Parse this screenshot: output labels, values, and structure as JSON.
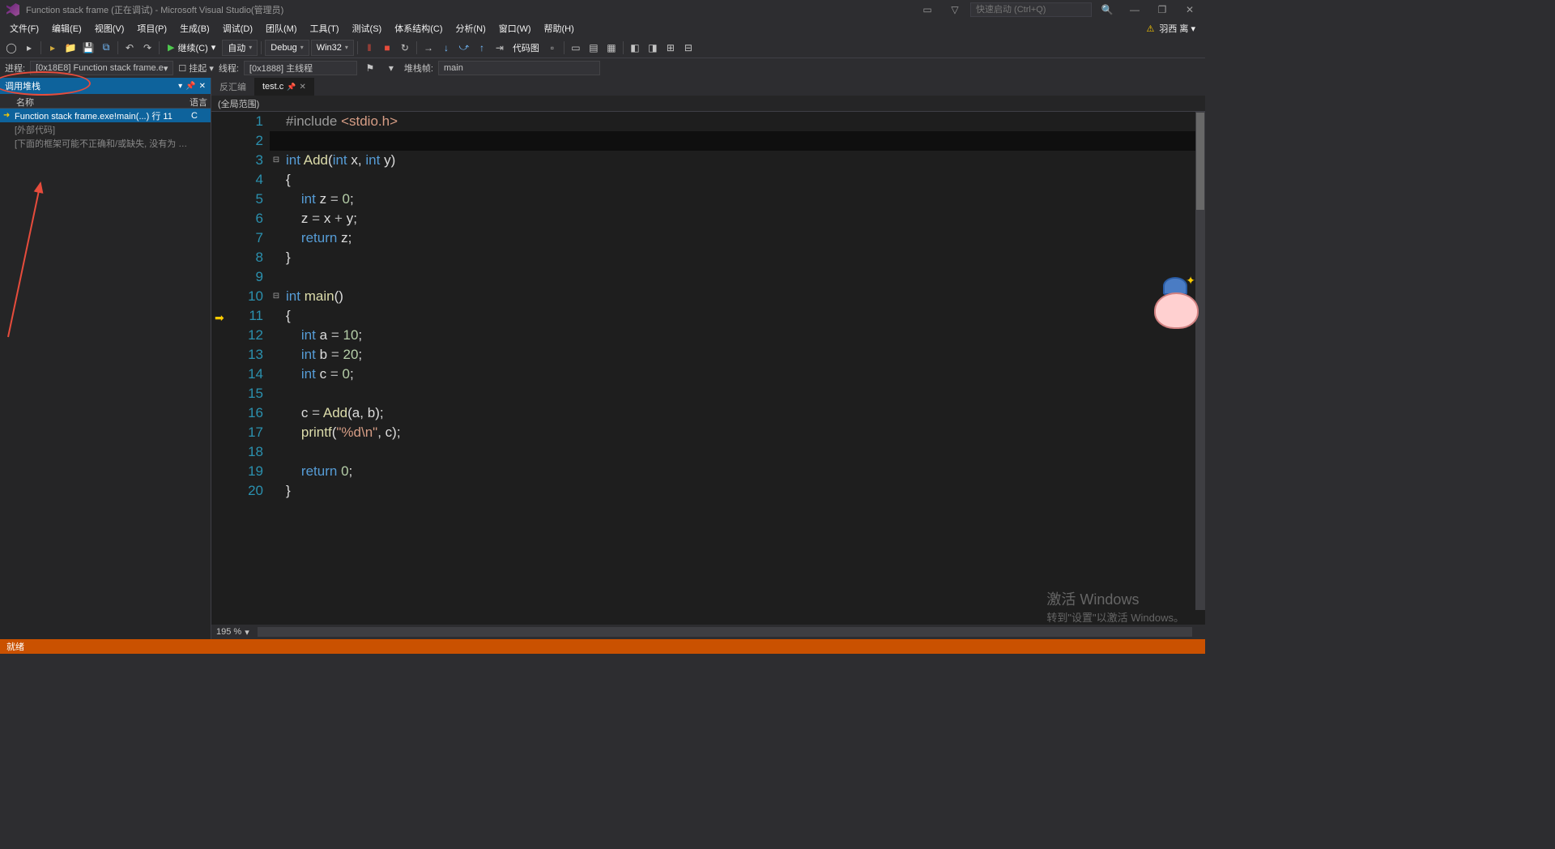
{
  "titlebar": {
    "title": "Function stack frame (正在调试) - Microsoft Visual Studio(管理员)",
    "search_placeholder": "快速启动 (Ctrl+Q)"
  },
  "menus": [
    "文件(F)",
    "编辑(E)",
    "视图(V)",
    "项目(P)",
    "生成(B)",
    "调试(D)",
    "团队(M)",
    "工具(T)",
    "测试(S)",
    "体系结构(C)",
    "分析(N)",
    "窗口(W)",
    "帮助(H)"
  ],
  "user_badge": "羽西 离 ▾",
  "toolbar": {
    "continue": "继续(C)",
    "config": "自动",
    "solution_cfg": "Debug",
    "platform": "Win32",
    "codemap": "代码图"
  },
  "process_bar": {
    "proc_label": "进程:",
    "proc_val": "[0x18E8] Function stack frame.e",
    "suspend": "挂起",
    "thread_label": "线程:",
    "thread_val": "[0x1888] 主线程",
    "frame_label": "堆栈帧:",
    "frame_val": "main"
  },
  "callstack": {
    "title": "调用堆栈",
    "col_name": "名称",
    "col_lang": "语言",
    "rows": [
      {
        "arrow": "➜",
        "name": "Function stack frame.exe!main(...) 行 11",
        "lang": "C",
        "selected": true
      },
      {
        "arrow": "",
        "name": "[外部代码]",
        "lang": "",
        "dim": true
      },
      {
        "arrow": "",
        "name": "[下面的框架可能不正确和/或缺失, 没有为 kernel",
        "lang": "",
        "dim": true
      }
    ]
  },
  "editor": {
    "tabs": [
      {
        "label": "反汇编",
        "active": false
      },
      {
        "label": "test.c",
        "active": true,
        "pinned": true
      }
    ],
    "scope": "(全局范围)",
    "zoom": "195 %",
    "lines": [
      1,
      2,
      3,
      4,
      5,
      6,
      7,
      8,
      9,
      10,
      11,
      12,
      13,
      14,
      15,
      16,
      17,
      18,
      19,
      20
    ],
    "code": [
      {
        "n": 1,
        "fold": "",
        "html": "<span class='pp'>#include</span> <span class='inc'>&lt;stdio.h&gt;</span>"
      },
      {
        "n": 2,
        "fold": "",
        "html": ""
      },
      {
        "n": 3,
        "fold": "⊟",
        "html": "<span class='ty'>int</span> <span class='fn'>Add</span><span class='pn'>(</span><span class='ty'>int</span> <span class='id'>x</span><span class='pn'>,</span> <span class='ty'>int</span> <span class='id'>y</span><span class='pn'>)</span>"
      },
      {
        "n": 4,
        "fold": "",
        "html": "<span class='pn'>{</span>"
      },
      {
        "n": 5,
        "fold": "",
        "html": "    <span class='ty'>int</span> <span class='id'>z</span> <span class='op'>=</span> <span class='num'>0</span><span class='pn'>;</span>"
      },
      {
        "n": 6,
        "fold": "",
        "html": "    <span class='id'>z</span> <span class='op'>=</span> <span class='id'>x</span> <span class='op'>+</span> <span class='id'>y</span><span class='pn'>;</span>"
      },
      {
        "n": 7,
        "fold": "",
        "html": "    <span class='kw'>return</span> <span class='id'>z</span><span class='pn'>;</span>"
      },
      {
        "n": 8,
        "fold": "",
        "html": "<span class='pn'>}</span>"
      },
      {
        "n": 9,
        "fold": "",
        "html": ""
      },
      {
        "n": 10,
        "fold": "⊟",
        "html": "<span class='ty'>int</span> <span class='fn'>main</span><span class='pn'>()</span>"
      },
      {
        "n": 11,
        "fold": "",
        "html": "<span class='pn'>{</span>"
      },
      {
        "n": 12,
        "fold": "",
        "html": "    <span class='ty'>int</span> <span class='id'>a</span> <span class='op'>=</span> <span class='num'>10</span><span class='pn'>;</span>"
      },
      {
        "n": 13,
        "fold": "",
        "html": "    <span class='ty'>int</span> <span class='id'>b</span> <span class='op'>=</span> <span class='num'>20</span><span class='pn'>;</span>"
      },
      {
        "n": 14,
        "fold": "",
        "html": "    <span class='ty'>int</span> <span class='id'>c</span> <span class='op'>=</span> <span class='num'>0</span><span class='pn'>;</span>"
      },
      {
        "n": 15,
        "fold": "",
        "html": ""
      },
      {
        "n": 16,
        "fold": "",
        "html": "    <span class='id'>c</span> <span class='op'>=</span> <span class='fn'>Add</span><span class='pn'>(</span><span class='id'>a</span><span class='pn'>,</span> <span class='id'>b</span><span class='pn'>)</span><span class='pn'>;</span>"
      },
      {
        "n": 17,
        "fold": "",
        "html": "    <span class='fn'>printf</span><span class='pn'>(</span><span class='str'>\"%d\\n\"</span><span class='pn'>,</span> <span class='id'>c</span><span class='pn'>)</span><span class='pn'>;</span>"
      },
      {
        "n": 18,
        "fold": "",
        "html": ""
      },
      {
        "n": 19,
        "fold": "",
        "html": "    <span class='kw'>return</span> <span class='num'>0</span><span class='pn'>;</span>"
      },
      {
        "n": 20,
        "fold": "",
        "html": "<span class='pn'>}</span>"
      }
    ]
  },
  "status": "就绪",
  "watermark": {
    "big": "激活 Windows",
    "small": "转到\"设置\"以激活 Windows。"
  }
}
